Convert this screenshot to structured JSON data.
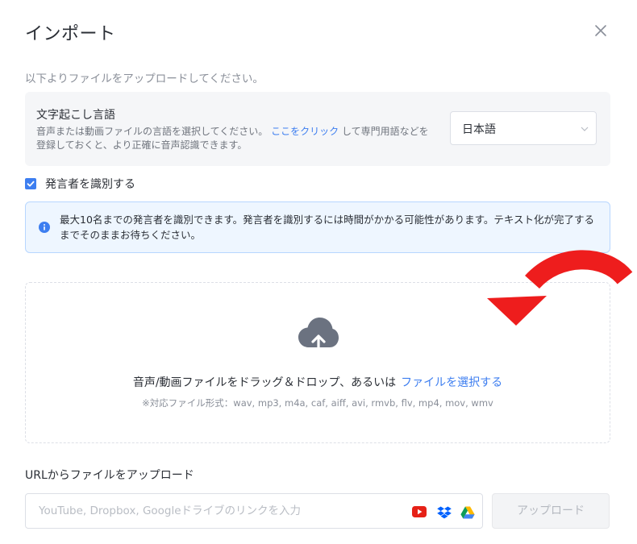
{
  "dialog": {
    "title": "インポート",
    "subtitle": "以下よりファイルをアップロードしてください。"
  },
  "language": {
    "title": "文字起こし言語",
    "desc_before": "音声または動画ファイルの言語を選択してください。",
    "desc_link": "ここをクリック",
    "desc_after": "して専門用語などを登録しておくと、より正確に音声認識できます。",
    "selected": "日本語"
  },
  "speaker": {
    "label": "発言者を識別する",
    "checked": true
  },
  "info": {
    "text": "最大10名までの発言者を識別できます。発言者を識別するには時間がかかる可能性があります。テキスト化が完了するまでそのままお待ちください。"
  },
  "dropzone": {
    "text": "音声/動画ファイルをドラッグ＆ドロップ、あるいは",
    "link": "ファイルを選択する",
    "formats": "※対応ファイル形式：wav, mp3, m4a, caf, aiff, avi, rmvb, flv, mp4, mov, wmv"
  },
  "url": {
    "label": "URLからファイルをアップロード",
    "placeholder": "YouTube, Dropbox, Googleドライブのリンクを入力",
    "value": "",
    "button": "アップロード",
    "services": [
      "youtube-icon",
      "dropbox-icon",
      "google-drive-icon"
    ]
  },
  "colors": {
    "accent": "#3d7ef0",
    "annotation_arrow": "#ee1d1d",
    "info_bg": "#eef6ff",
    "info_border": "#b7d6ff"
  },
  "icons": [
    "close-icon",
    "chevron-down-icon",
    "checkbox-checked-icon",
    "info-icon",
    "cloud-upload-icon",
    "curved-arrow-icon"
  ]
}
